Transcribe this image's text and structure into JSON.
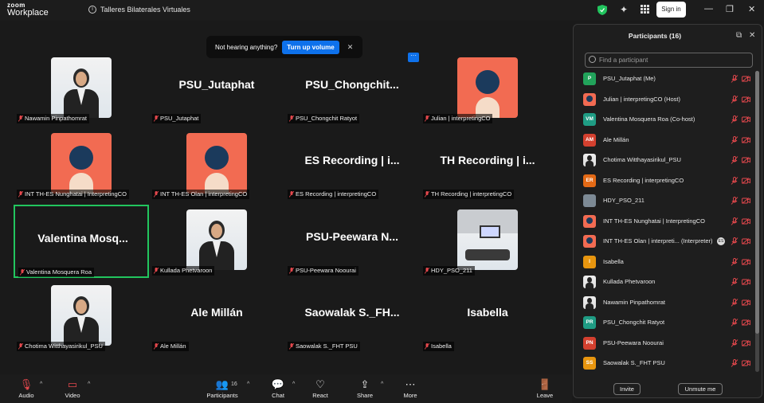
{
  "app": {
    "logo_top": "zoom",
    "logo_bottom": "Workplace",
    "meeting_title": "Talleres Bilaterales Virtuales",
    "sign_in": "Sign in"
  },
  "toast": {
    "text": "Not hearing anything?",
    "button": "Turn up volume",
    "close": "✕"
  },
  "tiles": [
    {
      "name": "Nawamin Pinpathomrat",
      "display": "photo-man",
      "big": ""
    },
    {
      "name": "PSU_Jutaphat",
      "display": "text",
      "big": "PSU_Jutaphat"
    },
    {
      "name": "PSU_Chongchit Ratyot",
      "display": "text",
      "big": "PSU_Chongchit..."
    },
    {
      "name": "Julian | interpretingCO",
      "display": "avatar",
      "big": ""
    },
    {
      "name": "INT TH-ES Nunghatai | InterpretingCO",
      "display": "avatar",
      "big": ""
    },
    {
      "name": "INT TH-ES Olan | interpretingCO",
      "display": "avatar",
      "big": ""
    },
    {
      "name": "ES Recording | interpretingCO",
      "display": "text",
      "big": "ES Recording | i..."
    },
    {
      "name": "TH Recording | interpretingCO",
      "display": "text",
      "big": "TH Recording | i..."
    },
    {
      "name": "Valentina Mosquera Roa",
      "display": "text",
      "big": "Valentina  Mosq..."
    },
    {
      "name": "Kullada Phetvaroon",
      "display": "photo-woman",
      "big": ""
    },
    {
      "name": "PSU-Peewara Noourai",
      "display": "text",
      "big": "PSU-Peewara  N..."
    },
    {
      "name": "HDY_PSO_211",
      "display": "room",
      "big": ""
    },
    {
      "name": "Chotima Witthayasirikul_PSU",
      "display": "photo-woman",
      "big": ""
    },
    {
      "name": "Ale Millán",
      "display": "text",
      "big": "Ale Millán"
    },
    {
      "name": "Saowalak S._FHT PSU",
      "display": "text",
      "big": "Saowalak S._FH..."
    },
    {
      "name": "Isabella",
      "display": "text",
      "big": "Isabella"
    }
  ],
  "toolbar": {
    "audio": "Audio",
    "video": "Video",
    "participants": "Participants",
    "participants_count": "16",
    "chat": "Chat",
    "react": "React",
    "share": "Share",
    "more": "More",
    "leave": "Leave"
  },
  "panel": {
    "title": "Participants (16)",
    "search_placeholder": "Find a participant",
    "invite": "Invite",
    "unmute": "Unmute me",
    "participants": [
      {
        "initials": "P",
        "color": "#22a35b",
        "name": "PSU_Jutaphat (Me)",
        "avatar": "initials"
      },
      {
        "initials": "",
        "color": "#f26b52",
        "name": "Julian | interpretingCO (Host)",
        "avatar": "coral"
      },
      {
        "initials": "VM",
        "color": "#1f9c84",
        "name": "Valentina Mosquera Roa (Co-host)",
        "avatar": "initials"
      },
      {
        "initials": "AM",
        "color": "#d3402f",
        "name": "Ale Millán",
        "avatar": "initials"
      },
      {
        "initials": "",
        "color": "#cfe0f0",
        "name": "Chotima Witthayasirikul_PSU",
        "avatar": "photo"
      },
      {
        "initials": "ER",
        "color": "#e46a16",
        "name": "ES Recording | interpretingCO",
        "avatar": "initials"
      },
      {
        "initials": "",
        "color": "#555",
        "name": "HDY_PSO_211",
        "avatar": "room"
      },
      {
        "initials": "",
        "color": "#f26b52",
        "name": "INT TH-ES Nunghatai | InterpretingCO",
        "avatar": "coral"
      },
      {
        "initials": "",
        "color": "#f26b52",
        "name": "INT TH-ES Olan | interpreti...  (Interpreter)",
        "avatar": "coral",
        "badge": "ES"
      },
      {
        "initials": "I",
        "color": "#e8960f",
        "name": "Isabella",
        "avatar": "initials"
      },
      {
        "initials": "",
        "color": "#cfe0f0",
        "name": "Kullada Phetvaroon",
        "avatar": "photo"
      },
      {
        "initials": "",
        "color": "#eee",
        "name": "Nawamin Pinpathomrat",
        "avatar": "photo"
      },
      {
        "initials": "PR",
        "color": "#1f9c84",
        "name": "PSU_Chongchit Ratyot",
        "avatar": "initials"
      },
      {
        "initials": "PN",
        "color": "#d3402f",
        "name": "PSU-Peewara Noourai",
        "avatar": "initials"
      },
      {
        "initials": "SS",
        "color": "#e8960f",
        "name": "Saowalak S._FHT PSU",
        "avatar": "initials"
      }
    ]
  },
  "colors": {
    "active_border": "#22c55e",
    "accent": "#0e71eb",
    "coral": "#f26b52",
    "muted": "#e5484d"
  }
}
